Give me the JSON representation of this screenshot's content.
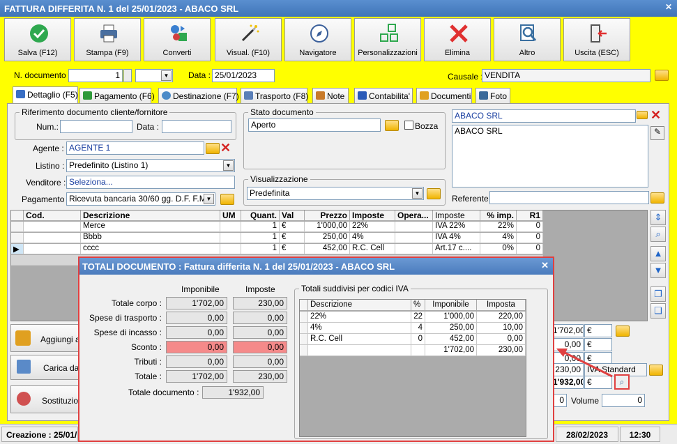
{
  "window": {
    "title": "FATTURA DIFFERITA N. 1 del 25/01/2023 - ABACO SRL"
  },
  "toolbar": [
    {
      "label": "Salva (F12)",
      "icon": "check-circle-icon"
    },
    {
      "label": "Stampa (F9)",
      "icon": "printer-icon"
    },
    {
      "label": "Converti",
      "icon": "convert-icon"
    },
    {
      "label": "Visual. (F10)",
      "icon": "magic-wand-icon"
    },
    {
      "label": "Navigatore",
      "icon": "compass-icon"
    },
    {
      "label": "Personalizzazioni",
      "icon": "grid-squares-icon"
    },
    {
      "label": "Elimina",
      "icon": "delete-x-icon"
    },
    {
      "label": "Altro",
      "icon": "magnifier-icon"
    },
    {
      "label": "Uscita (ESC)",
      "icon": "exit-door-icon"
    }
  ],
  "header": {
    "doc_number_label": "N. documento :",
    "doc_number": "1",
    "date_label": "Data :",
    "date": "25/01/2023",
    "causale_label": "Causale :",
    "causale": "VENDITA"
  },
  "tabs": [
    {
      "label": "Dettaglio (F5)",
      "active": true,
      "color": "#3a6fc4"
    },
    {
      "label": "Pagamento (F6)",
      "active": false,
      "color": "#2f9a3a"
    },
    {
      "label": "Destinazione (F7)",
      "active": false,
      "color": "#4a8ac8"
    },
    {
      "label": "Trasporto (F8)",
      "active": false,
      "color": "#5a7fb8"
    },
    {
      "label": "Note",
      "active": false,
      "color": "#c87a2a"
    },
    {
      "label": "Contabilita'",
      "active": false,
      "color": "#2a5ab8"
    },
    {
      "label": "Documenti",
      "active": false,
      "color": "#e0a020"
    },
    {
      "label": "Foto",
      "active": false,
      "color": "#3a6a9a"
    }
  ],
  "riferimento": {
    "title": "Riferimento documento cliente/fornitore",
    "num_label": "Num.:",
    "num": "",
    "data_label": "Data :",
    "data": ""
  },
  "stato": {
    "title": "Stato documento",
    "value": "Aperto",
    "bozza_label": "Bozza"
  },
  "agente": {
    "label": "Agente :",
    "value": "AGENTE 1"
  },
  "listino": {
    "label": "Listino :",
    "value": "Predefinito (Listino 1)"
  },
  "venditore": {
    "label": "Venditore :",
    "value": "Seleziona..."
  },
  "pagamento": {
    "label": "Pagamento :",
    "value": "Ricevuta bancaria 30/60 gg. D.F. F.M."
  },
  "visualizzazione": {
    "title": "Visualizzazione",
    "value": "Predefinita"
  },
  "cliente": {
    "name": "ABACO SRL",
    "address": "ABACO SRL",
    "referente_label": "Referente",
    "referente": ""
  },
  "grid": {
    "headers": [
      "Cod.",
      "Descrizione",
      "UM",
      "Quant.",
      "Val",
      "Prezzo",
      "Imposte",
      "Opera...",
      "Imposte",
      "% imp.",
      "R1"
    ],
    "rows": [
      [
        "",
        "Merce",
        "",
        "1",
        "€",
        "1'000,00",
        "22%",
        "",
        "IVA 22%",
        "22%",
        "0"
      ],
      [
        "",
        "Bbbb",
        "",
        "1",
        "€",
        "250,00",
        "4%",
        "",
        "IVA 4%",
        "4%",
        "0"
      ],
      [
        "",
        "cccc",
        "",
        "1",
        "€",
        "452,00",
        "R.C. Cell",
        "",
        "Art.17 c....",
        "0%",
        "0"
      ]
    ]
  },
  "bottom_buttons": [
    {
      "label": "Aggiungi art",
      "icon": "add-article-icon"
    },
    {
      "label": "Carica da a",
      "icon": "load-checklist-icon"
    },
    {
      "label": "Sostituzione",
      "icon": "replace-icon"
    }
  ],
  "right_totals": {
    "v1": "1'702,00",
    "c1": "€",
    "v2": "0,00",
    "c2": "€",
    "v3": "0,00",
    "c3": "€",
    "v4": "230,00",
    "c4": "IVA Standard",
    "v5": "1'932,00",
    "c5": "€",
    "v6": "0",
    "volume_label": "Volume :",
    "volume": "0"
  },
  "status": {
    "created": "Creazione : 25/01/",
    "date": "28/02/2023",
    "time": "12:30"
  },
  "dialog": {
    "title": "TOTALI DOCUMENTO : Fattura differita N. 1 del 25/01/2023 - ABACO SRL",
    "col_imponibile": "Imponibile",
    "col_imposte": "Imposte",
    "rows": [
      {
        "label": "Totale corpo :",
        "imponibile": "1'702,00",
        "imposte": "230,00",
        "highlight": false
      },
      {
        "label": "Spese di trasporto :",
        "imponibile": "0,00",
        "imposte": "0,00",
        "highlight": false
      },
      {
        "label": "Spese di incasso :",
        "imponibile": "0,00",
        "imposte": "0,00",
        "highlight": false
      },
      {
        "label": "Sconto :",
        "imponibile": "0,00",
        "imposte": "0,00",
        "highlight": true
      },
      {
        "label": "Tributi :",
        "imponibile": "0,00",
        "imposte": "0,00",
        "highlight": false
      },
      {
        "label": "Totale :",
        "imponibile": "1'702,00",
        "imposte": "230,00",
        "highlight": false
      }
    ],
    "totale_documento_label": "Totale documento :",
    "totale_documento": "1'932,00",
    "iva_group_title": "Totali suddivisi per codici IVA",
    "iva_headers": [
      "Descrizione",
      "%",
      "Imponibile",
      "Imposta"
    ],
    "iva_rows": [
      [
        "22%",
        "22",
        "1'000,00",
        "220,00"
      ],
      [
        "4%",
        "4",
        "250,00",
        "10,00"
      ],
      [
        "R.C. Cell",
        "0",
        "452,00",
        "0,00"
      ],
      [
        "",
        "",
        "1'702,00",
        "230,00"
      ]
    ],
    "accent": "#e04040"
  }
}
